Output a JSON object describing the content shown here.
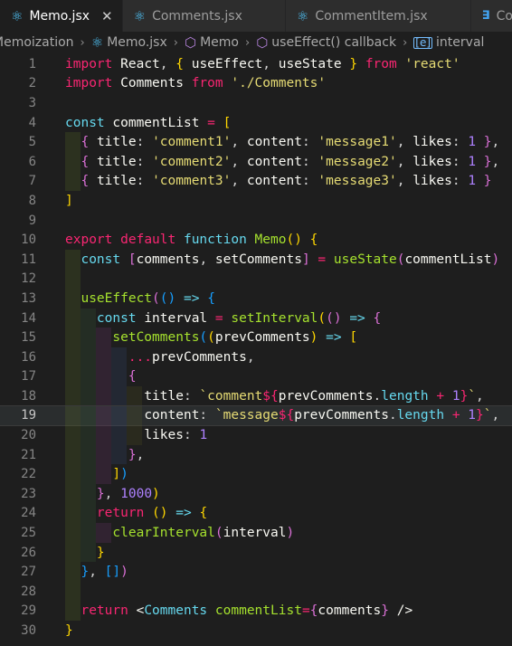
{
  "tabs": [
    {
      "label": "Memo.jsx",
      "active": true,
      "icon": "react-icon"
    },
    {
      "label": "Comments.jsx",
      "active": false,
      "icon": "react-icon"
    },
    {
      "label": "CommentItem.jsx",
      "active": false,
      "icon": "react-icon"
    },
    {
      "label": "Co",
      "active": false,
      "icon": "css-icon"
    }
  ],
  "breadcrumb": [
    "Memoization",
    "Memo.jsx",
    "Memo",
    "useEffect() callback",
    "interval"
  ],
  "current_line": 19,
  "lines": [
    {
      "n": "1"
    },
    {
      "n": "2"
    },
    {
      "n": "3"
    },
    {
      "n": "4"
    },
    {
      "n": "5"
    },
    {
      "n": "6"
    },
    {
      "n": "7"
    },
    {
      "n": "8"
    },
    {
      "n": "9"
    },
    {
      "n": "10"
    },
    {
      "n": "11"
    },
    {
      "n": "12"
    },
    {
      "n": "13"
    },
    {
      "n": "14"
    },
    {
      "n": "15"
    },
    {
      "n": "16"
    },
    {
      "n": "17"
    },
    {
      "n": "18"
    },
    {
      "n": "19"
    },
    {
      "n": "20"
    },
    {
      "n": "21"
    },
    {
      "n": "22"
    },
    {
      "n": "23"
    },
    {
      "n": "24"
    },
    {
      "n": "25"
    },
    {
      "n": "26"
    },
    {
      "n": "27"
    },
    {
      "n": "28"
    },
    {
      "n": "29"
    },
    {
      "n": "30"
    }
  ],
  "code": {
    "import_kw": "import",
    "react": "React",
    "useEffect": "useEffect",
    "useState": "useState",
    "from_kw": "from",
    "react_str": "'react'",
    "comments_id": "Comments",
    "comments_path": "'./Comments'",
    "const_kw": "const",
    "commentList": "commentList",
    "title_key": "title",
    "content_key": "content",
    "likes_key": "likes",
    "c1": "'comment1'",
    "m1": "'message1'",
    "c2": "'comment2'",
    "m2": "'message2'",
    "c3": "'comment3'",
    "m3": "'message3'",
    "one": "1",
    "export_kw": "export",
    "default_kw": "default",
    "function_kw": "function",
    "memo_fn": "Memo",
    "comments_var": "comments",
    "setComments": "setComments",
    "interval_var": "interval",
    "setInterval": "setInterval",
    "prevComments": "prevComments",
    "spread": "...",
    "tpl_comment": "`comment",
    "tpl_message": "`message",
    "length": "length",
    "tick": "`",
    "thousand": "1000",
    "return_kw": "return",
    "clearInterval": "clearInterval",
    "jsx_tag": "Comments",
    "jsx_attr": "commentList"
  },
  "colors": {
    "background": "#1e1e1e",
    "keyword": "#f92672",
    "string": "#e6db74",
    "number": "#ae81ff",
    "function": "#a6e22e"
  }
}
